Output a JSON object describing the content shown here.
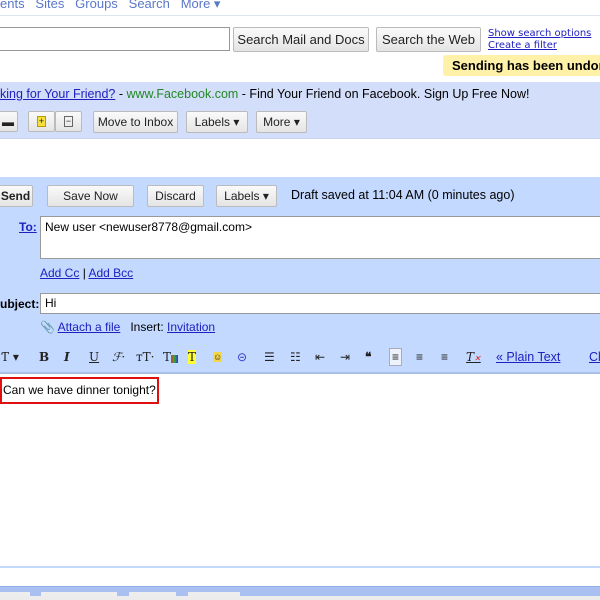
{
  "topnav": {
    "items": [
      "ents",
      "Sites",
      "Groups",
      "Search",
      "More ▾"
    ]
  },
  "search": {
    "value": "",
    "mail_button": "Search Mail and Docs",
    "web_button": "Search the Web",
    "show_options": "Show search options",
    "create_filter": "Create a filter"
  },
  "notice": "Sending has been undon",
  "ad": {
    "link": "king for Your Friend?",
    "sep1": " - ",
    "url": "www.Facebook.com",
    "text": " - Find Your Friend on Facebook. Sign Up Free Now!"
  },
  "toolbar": {
    "move_to_inbox": "Move to Inbox",
    "labels": "Labels ▾",
    "more": "More ▾"
  },
  "compose": {
    "send": "Send",
    "save_now": "Save Now",
    "discard": "Discard",
    "labels": "Labels ▾",
    "draft_status": "Draft saved at 11:04 AM (0 minutes ago)",
    "to_label": "To:",
    "to_value": "New user <newuser8778@gmail.com>",
    "add_cc": "Add Cc",
    "cc_sep": " | ",
    "add_bcc": "Add Bcc",
    "subject_label": "ubject:",
    "subject_value": "Hi",
    "attach": "Attach a file",
    "insert_label": "Insert:",
    "invitation": "Invitation",
    "plain_text": "« Plain Text",
    "check": "Cl",
    "body": "Can we have dinner tonight?"
  },
  "colors": {
    "compose_blue": "#c3d9ff",
    "notice_yellow": "#fff1a8",
    "highlight": "#e01010"
  }
}
